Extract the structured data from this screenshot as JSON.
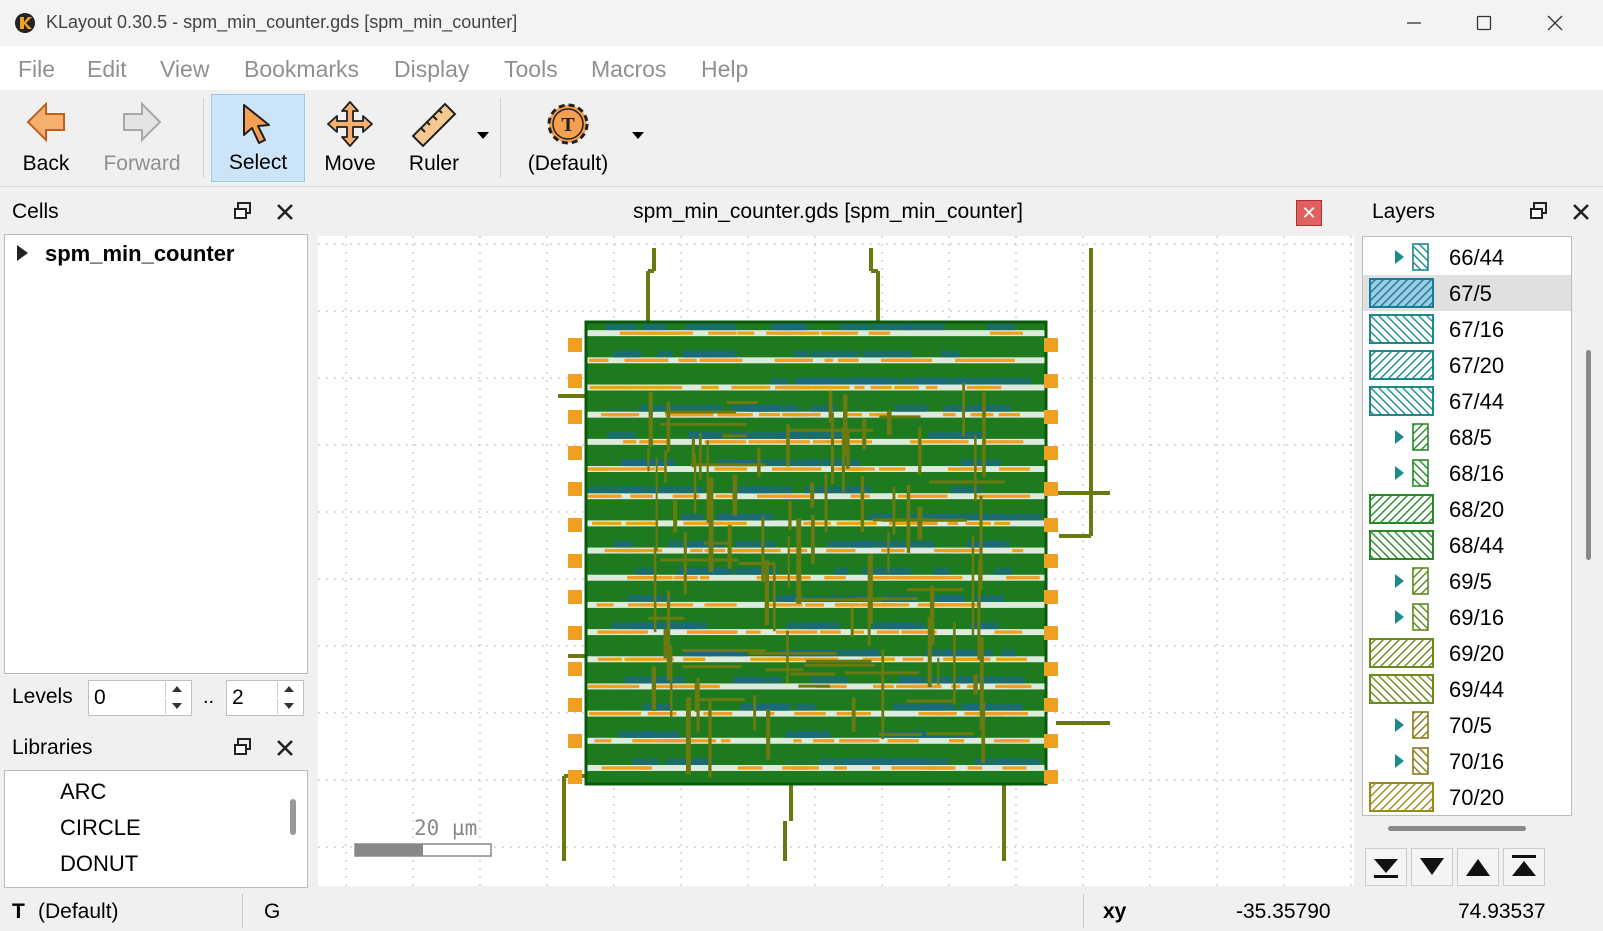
{
  "window": {
    "title": "KLayout 0.30.5 - spm_min_counter.gds [spm_min_counter]"
  },
  "menu": [
    "File",
    "Edit",
    "View",
    "Bookmarks",
    "Display",
    "Tools",
    "Macros",
    "Help"
  ],
  "toolbar": {
    "back": "Back",
    "forward": "Forward",
    "select": "Select",
    "move": "Move",
    "ruler": "Ruler",
    "default": "(Default)"
  },
  "cells_panel": {
    "title": "Cells",
    "root_cell": "spm_min_counter",
    "levels_label": "Levels",
    "levels_from": "0",
    "levels_sep": "..",
    "levels_to": "2"
  },
  "libraries_panel": {
    "title": "Libraries",
    "items": [
      "ARC",
      "CIRCLE",
      "DONUT"
    ]
  },
  "view": {
    "tab_title": "spm_min_counter.gds [spm_min_counter]",
    "scale_bar": "20 µm"
  },
  "layers_panel": {
    "title": "Layers",
    "layers": [
      {
        "name": "66/44",
        "color": "#1a8a8a",
        "pattern": "back",
        "group": true,
        "selected": false
      },
      {
        "name": "67/5",
        "color": "#1a7a9a",
        "pattern": "fwd",
        "group": false,
        "selected": true
      },
      {
        "name": "67/16",
        "color": "#1a8a8a",
        "pattern": "back",
        "group": false,
        "selected": false
      },
      {
        "name": "67/20",
        "color": "#1a8a8a",
        "pattern": "fwd",
        "group": false,
        "selected": false
      },
      {
        "name": "67/44",
        "color": "#1a8a8a",
        "pattern": "back",
        "group": false,
        "selected": false
      },
      {
        "name": "68/5",
        "color": "#2a8a2a",
        "pattern": "fwd",
        "group": true,
        "selected": false
      },
      {
        "name": "68/16",
        "color": "#2a8a2a",
        "pattern": "back",
        "group": true,
        "selected": false
      },
      {
        "name": "68/20",
        "color": "#2a8a2a",
        "pattern": "fwd",
        "group": false,
        "selected": false
      },
      {
        "name": "68/44",
        "color": "#2a8a2a",
        "pattern": "back",
        "group": false,
        "selected": false
      },
      {
        "name": "69/5",
        "color": "#5a8a1a",
        "pattern": "fwd",
        "group": true,
        "selected": false
      },
      {
        "name": "69/16",
        "color": "#5a8a1a",
        "pattern": "back",
        "group": true,
        "selected": false
      },
      {
        "name": "69/20",
        "color": "#6a8a1a",
        "pattern": "fwd",
        "group": false,
        "selected": false
      },
      {
        "name": "69/44",
        "color": "#6a8a1a",
        "pattern": "back",
        "group": false,
        "selected": false
      },
      {
        "name": "70/5",
        "color": "#8a7a1a",
        "pattern": "fwd",
        "group": true,
        "selected": false
      },
      {
        "name": "70/16",
        "color": "#8a7a1a",
        "pattern": "back",
        "group": true,
        "selected": false
      },
      {
        "name": "70/20",
        "color": "#9a8a1a",
        "pattern": "fwd",
        "group": false,
        "selected": false
      }
    ]
  },
  "status_bar": {
    "mode_icon": "T",
    "mode": "(Default)",
    "grid": "G",
    "coord_label": "xy",
    "x": "-35.35790",
    "y": "74.93537"
  },
  "colors": {
    "fill_green": "#1e7a1e",
    "wire_olive": "#6a7a10",
    "label_orange": "#f0a020",
    "cyan_layer": "#1a6a7a"
  }
}
